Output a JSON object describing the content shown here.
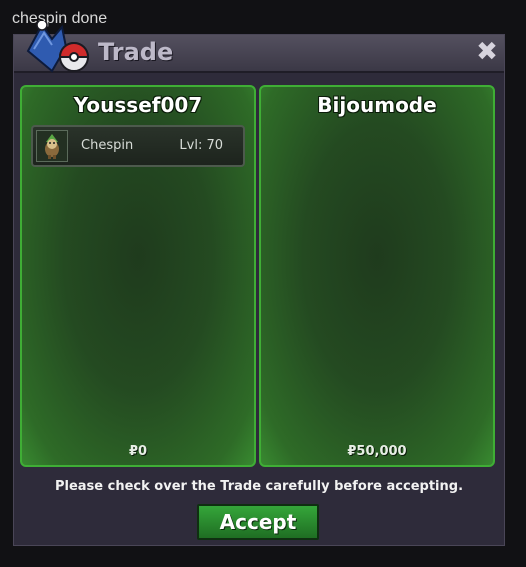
{
  "caption": "chespin done",
  "window": {
    "title": "Trade",
    "close_label": "✖"
  },
  "left_panel": {
    "player": "Youssef007",
    "items": [
      {
        "name": "Chespin",
        "level": "Lvl: 70"
      }
    ],
    "money": "₽0"
  },
  "right_panel": {
    "player": "Bijoumode",
    "money": "₽50,000"
  },
  "notice": "Please check over the Trade carefully before accepting.",
  "accept_label": "Accept",
  "colors": {
    "panel_border": "#3fae35",
    "window_bg": "#2e2b3a",
    "accept_button": "#2c8f31"
  }
}
